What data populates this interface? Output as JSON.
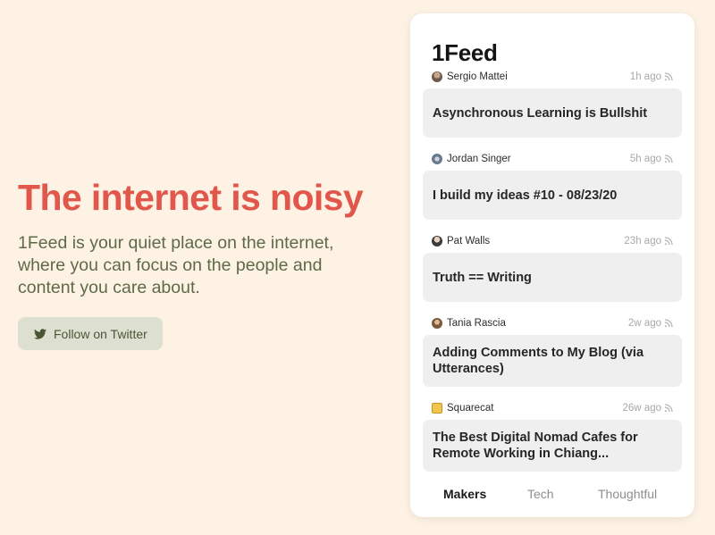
{
  "hero": {
    "title": "The internet is noisy",
    "subtitle": "1Feed is your quiet place on the internet, where you can focus on the people and content you care about.",
    "twitter_button": "Follow on Twitter"
  },
  "app": {
    "title": "1Feed"
  },
  "feed": [
    {
      "author": "Sergio Mattei",
      "time": "1h ago",
      "title": "Asynchronous Learning is Bullshit",
      "avatar": "avatar-photo"
    },
    {
      "author": "Jordan Singer",
      "time": "5h ago",
      "title": "I build my ideas #10 - 08/23/20",
      "avatar": "avatar-photo"
    },
    {
      "author": "Pat Walls",
      "time": "23h ago",
      "title": "Truth == Writing",
      "avatar": "avatar-photo"
    },
    {
      "author": "Tania Rascia",
      "time": "2w ago",
      "title": "Adding Comments to My Blog (via Utterances)",
      "avatar": "avatar-photo"
    },
    {
      "author": "Squarecat",
      "time": "26w ago",
      "title": "The Best Digital Nomad Cafes for Remote Working in Chiang...",
      "avatar": "cat-logo"
    }
  ],
  "tabs": [
    {
      "label": "Makers",
      "active": true
    },
    {
      "label": "Tech",
      "active": false
    },
    {
      "label": "Thoughtful",
      "active": false
    }
  ],
  "colors": {
    "background": "#fdf2e4",
    "accent": "#e2574c",
    "subtitle": "#5f6a48",
    "button_bg": "#dde0d1"
  },
  "icons": {
    "twitter": "twitter-icon",
    "rss": "rss-icon"
  }
}
